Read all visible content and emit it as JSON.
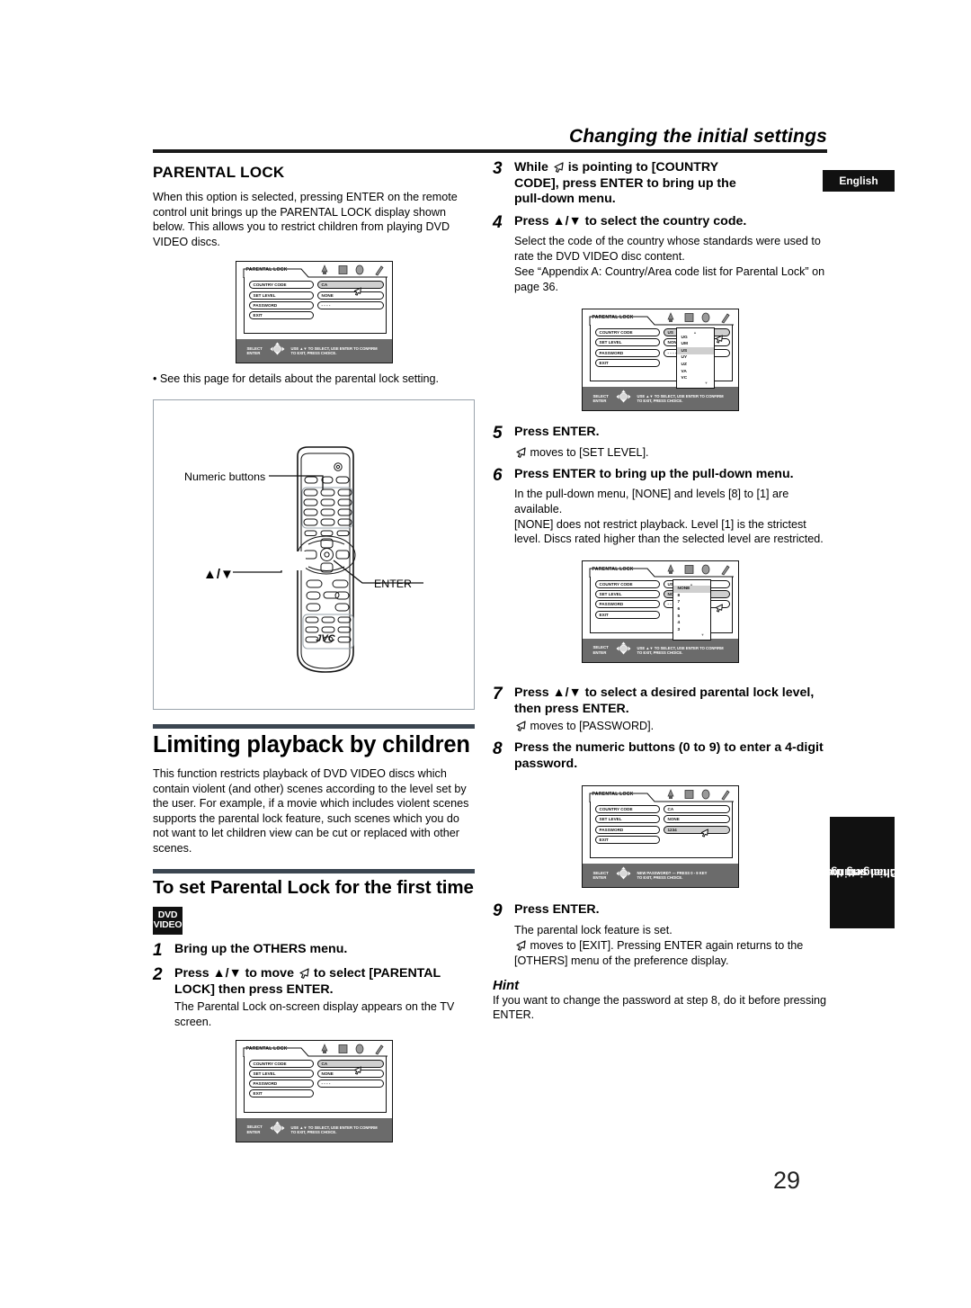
{
  "header": {
    "title": "Changing the initial settings",
    "language_badge": "English",
    "side_tab_line1": "Changing the",
    "side_tab_line2": "initial settings",
    "page_number": "29"
  },
  "left_column": {
    "section_title": "PARENTAL LOCK",
    "intro_paragraph": "When this option is selected, pressing ENTER on the remote control unit brings up the PARENTAL LOCK display shown below. This allows you to restrict children from playing DVD VIDEO discs.",
    "bullet_note": "• See this page for details about the parental lock setting.",
    "remote_figure": {
      "label_numeric": "Numeric buttons",
      "label_updown": "▲/▼",
      "label_enter": "ENTER",
      "brand": "JVC"
    },
    "heading_limiting": "Limiting playback by children",
    "limiting_paragraph": "This function restricts playback of DVD VIDEO discs which contain violent (and other) scenes according to the level set by the user. For example, if a movie which includes violent scenes supports the parental lock feature, such scenes which you do not want to let children view can be cut or replaced with other scenes.",
    "heading_first_time": "To set Parental Lock for the first time",
    "dvd_logo_line1": "DVD",
    "dvd_logo_line2": "VIDEO",
    "steps": [
      {
        "num": "1",
        "text": "Bring up the OTHERS menu.",
        "sub": ""
      },
      {
        "num": "2",
        "text_before_cursor": "Press ▲/▼ to move ",
        "text_after_cursor": " to select [PARENTAL LOCK] then press ENTER.",
        "sub": "The Parental Lock on-screen display appears on the TV screen."
      }
    ]
  },
  "right_column": {
    "steps": [
      {
        "num": "3",
        "text_before_cursor": "While ",
        "text_after_cursor": " is pointing to [COUNTRY CODE], press ENTER to bring up the pull-down menu.",
        "sub": ""
      },
      {
        "num": "4",
        "text": "Press ▲/▼ to select the country code.",
        "sub": "Select the code of the country whose standards were used to rate the DVD VIDEO disc content.\nSee “Appendix A: Country/Area code list for Parental Lock” on page 36."
      },
      {
        "num": "5",
        "text": "Press ENTER.",
        "sub_after_cursor": " moves to [SET LEVEL]."
      },
      {
        "num": "6",
        "text": "Press ENTER to bring up the pull-down menu.",
        "sub": "In the pull-down menu, [NONE] and levels [8] to [1] are available.\n[NONE] does not restrict playback. Level [1] is the strictest level. Discs rated higher than the selected level are restricted."
      },
      {
        "num": "7",
        "text": "Press ▲/▼ to select a desired parental lock level, then press ENTER.",
        "sub_after_cursor": " moves to [PASSWORD]."
      },
      {
        "num": "8",
        "text": "Press the numeric buttons (0 to 9) to enter a 4-digit password.",
        "sub": ""
      },
      {
        "num": "9",
        "text": "Press ENTER.",
        "sub": "The parental lock feature is set.",
        "sub_after_cursor": " moves to [EXIT]. Pressing ENTER again returns to the [OTHERS] menu of the preference display."
      }
    ],
    "hint_title": "Hint",
    "hint_text": "If you want to change the password at step 8, do it before pressing ENTER."
  },
  "osd_screens": {
    "screen_a": {
      "title": "PARENTAL LOCK",
      "rows": [
        {
          "label": "COUNTRY CODE",
          "value": "CA",
          "highlight": true
        },
        {
          "label": "SET LEVEL",
          "value": "NONE",
          "highlight": false
        },
        {
          "label": "PASSWORD",
          "value": "- - - -",
          "highlight": false
        }
      ],
      "exit_label": "EXIT",
      "bar_left_line1": "SELECT",
      "bar_left_line2": "ENTER",
      "bar_right_line1": "USE ▲▼ TO SELECT, USE ENTER TO CONFIRM",
      "bar_right_line2": "TO EXIT, PRESS CHOICE."
    },
    "screen_b": {
      "title": "PARENTAL LOCK",
      "rows": [
        {
          "label": "COUNTRY CODE",
          "value": "US",
          "highlight": true
        },
        {
          "label": "SET LEVEL",
          "value": "NONE",
          "highlight": false
        },
        {
          "label": "PASSWORD",
          "value": "- - - -",
          "highlight": false
        }
      ],
      "exit_label": "EXIT",
      "dropdown": [
        "UG",
        "UM",
        "US",
        "UY",
        "UZ",
        "VA",
        "VC"
      ],
      "dropdown_selected": "US",
      "bar_left_line1": "SELECT",
      "bar_left_line2": "ENTER",
      "bar_right_line1": "USE ▲▼ TO SELECT, USE ENTER TO CONFIRM",
      "bar_right_line2": "TO EXIT, PRESS CHOICE."
    },
    "screen_c": {
      "title": "PARENTAL LOCK",
      "rows": [
        {
          "label": "COUNTRY CODE",
          "value": "US",
          "highlight": false
        },
        {
          "label": "SET LEVEL",
          "value": "NONE",
          "highlight": true
        },
        {
          "label": "PASSWORD",
          "value": "- - - -",
          "highlight": false
        }
      ],
      "exit_label": "EXIT",
      "dropdown": [
        "NONE",
        "8",
        "7",
        "6",
        "5",
        "4",
        "3"
      ],
      "dropdown_selected": "NONE",
      "bar_left_line1": "SELECT",
      "bar_left_line2": "ENTER",
      "bar_right_line1": "USE ▲▼ TO SELECT, USE ENTER TO CONFIRM",
      "bar_right_line2": "TO EXIT, PRESS CHOICE."
    },
    "screen_d": {
      "title": "PARENTAL LOCK",
      "rows": [
        {
          "label": "COUNTRY CODE",
          "value": "CA",
          "highlight": false
        },
        {
          "label": "SET LEVEL",
          "value": "NONE",
          "highlight": false
        },
        {
          "label": "PASSWORD",
          "value": "1234",
          "highlight": true
        }
      ],
      "exit_label": "EXIT",
      "bar_left_line1": "SELECT",
      "bar_left_line2": "ENTER",
      "bar_right_line1": "NEW PASSWORD? --- PRESS 0 - 9 KEY",
      "bar_right_line2": "TO EXIT, PRESS CHOICE."
    },
    "screen_e": {
      "title": "PARENTAL LOCK",
      "rows": [
        {
          "label": "COUNTRY CODE",
          "value": "CA",
          "highlight": true
        },
        {
          "label": "SET LEVEL",
          "value": "NONE",
          "highlight": false
        },
        {
          "label": "PASSWORD",
          "value": "- - - -",
          "highlight": false
        }
      ],
      "exit_label": "EXIT",
      "bar_left_line1": "SELECT",
      "bar_left_line2": "ENTER",
      "bar_right_line1": "USE ▲▼ TO SELECT, USE ENTER TO CONFIRM",
      "bar_right_line2": "TO EXIT, PRESS CHOICE."
    }
  },
  "colors": {
    "rule": "#3b4651",
    "osd_bar": "#6b6b6b",
    "highlight": "#cfcfcf",
    "badge": "#111111"
  }
}
